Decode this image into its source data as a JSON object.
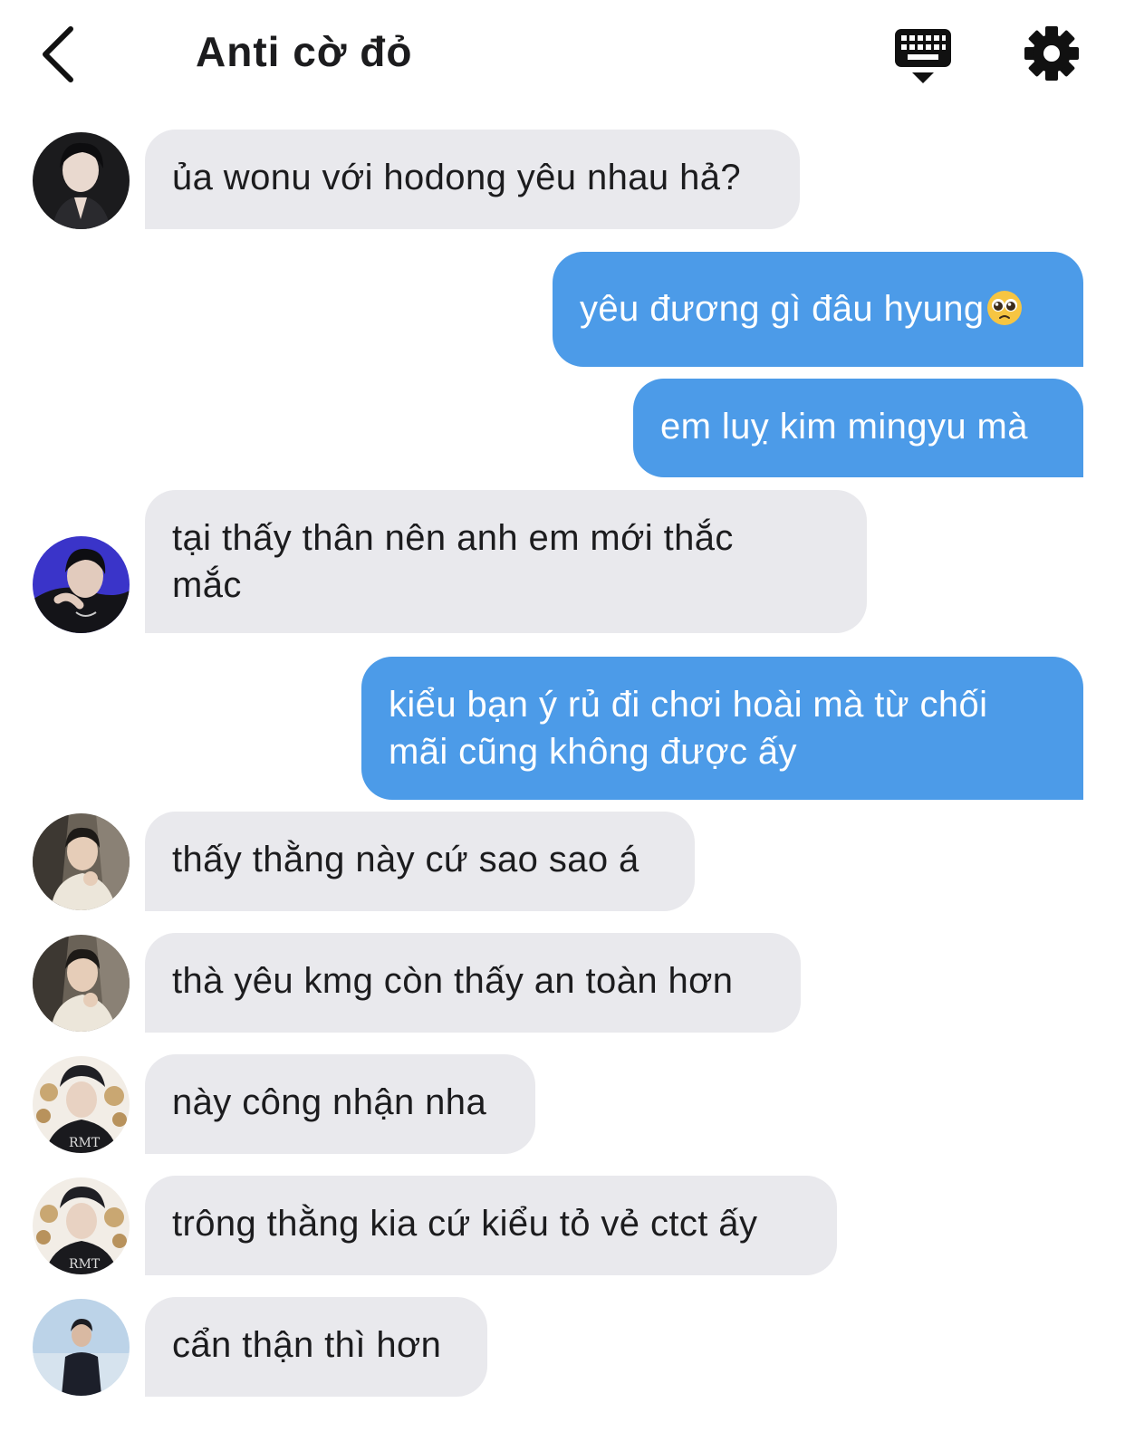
{
  "header": {
    "title": "Anti cờ đỏ",
    "back_icon": "chevron-left-icon",
    "keyboard_icon": "keyboard-icon",
    "settings_icon": "gear-icon"
  },
  "colors": {
    "incoming_bubble": "#e9e9ed",
    "outgoing_bubble": "#4c9be8"
  },
  "messages": [
    {
      "side": "incoming",
      "text": "ủa wonu với hodong yêu nhau hả?"
    },
    {
      "side": "outgoing",
      "text": "yêu đương gì đâu hyung",
      "emoji": "pleading-face-emoji"
    },
    {
      "side": "outgoing",
      "text": "em luỵ kim mingyu mà"
    },
    {
      "side": "incoming",
      "line1": "tại thấy thân nên anh em mới thắc",
      "line2": "mắc"
    },
    {
      "side": "outgoing",
      "line1": "kiểu bạn ý rủ đi chơi hoài mà từ chối",
      "line2": "mãi cũng không được ấy"
    },
    {
      "side": "incoming",
      "text": "thấy thằng này cứ sao sao á"
    },
    {
      "side": "incoming",
      "text": "thà yêu kmg còn thấy an toàn hơn"
    },
    {
      "side": "incoming",
      "text": "này công nhận nha"
    },
    {
      "side": "incoming",
      "text": "trông thằng kia cứ kiểu tỏ vẻ ctct ấy"
    },
    {
      "side": "incoming",
      "text": "cẩn thận thì hơn"
    }
  ]
}
